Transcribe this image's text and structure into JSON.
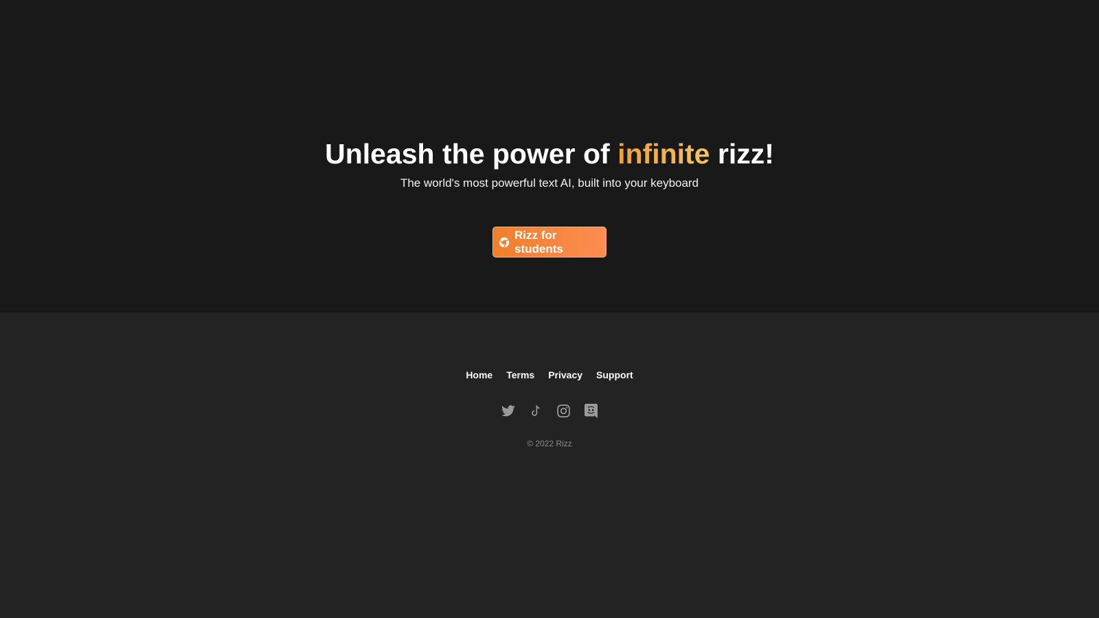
{
  "hero": {
    "headline_before": "Unleash the power of ",
    "headline_highlight": "infinite",
    "headline_after": " rizz!",
    "subtitle": "The world's most powerful text AI, built into your keyboard",
    "cta_label": "Rizz for students",
    "cta_icon": "chrome-icon"
  },
  "footer": {
    "nav": [
      "Home",
      "Terms",
      "Privacy",
      "Support"
    ],
    "social_icons": [
      "twitter-icon",
      "tiktok-icon",
      "instagram-icon",
      "discord-icon"
    ],
    "copyright": "© 2022 Rizz"
  },
  "colors": {
    "hero_bg": "#191919",
    "footer_bg": "#232323",
    "accent_highlight": "#f0a13a",
    "cta_gradient_start": "#f07f2c",
    "cta_gradient_end": "#fb8d53",
    "muted_text": "#8c8c8c"
  }
}
